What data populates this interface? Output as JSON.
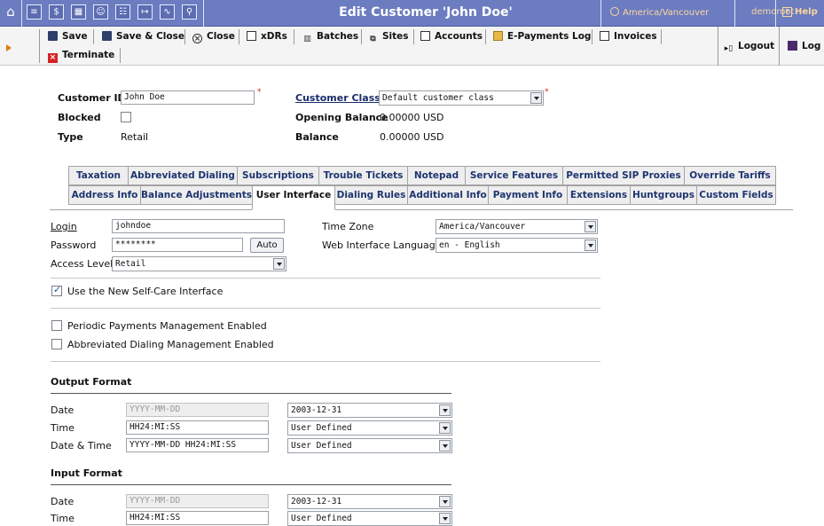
{
  "header": {
    "title": "Edit Customer 'John Doe'",
    "timezone": "America/Vancouver",
    "user": "demoroot",
    "help": "Help",
    "icons": [
      "home-icon",
      "list-icon",
      "dollar-icon",
      "grid-icon",
      "person-icon",
      "table-icon",
      "exit-icon",
      "chart-icon",
      "search-icon"
    ]
  },
  "toolbar": {
    "save": "Save",
    "save_close": "Save & Close",
    "close": "Close",
    "xdrs": "xDRs",
    "batches": "Batches",
    "sites": "Sites",
    "accounts": "Accounts",
    "epayments": "E-Payments Log",
    "invoices": "Invoices",
    "terminate": "Terminate",
    "logout": "Logout",
    "log": "Log"
  },
  "customer": {
    "id_label": "Customer ID",
    "id_value": "John Doe",
    "blocked_label": "Blocked",
    "type_label": "Type",
    "type_value": "Retail",
    "class_label": "Customer Class",
    "class_value": "Default customer class",
    "opening_label": "Opening Balance",
    "opening_value": "0.00000 USD",
    "balance_label": "Balance",
    "balance_value": "0.00000 USD"
  },
  "tabs_row1": [
    "Taxation",
    "Abbreviated Dialing",
    "Subscriptions",
    "Trouble Tickets",
    "Notepad",
    "Service Features",
    "Permitted SIP Proxies",
    "Override Tariffs"
  ],
  "tabs_row2": [
    "Address Info",
    "Balance Adjustments",
    "User Interface",
    "Dialing Rules",
    "Additional Info",
    "Payment Info",
    "Extensions",
    "Huntgroups",
    "Custom Fields"
  ],
  "active_tab": "User Interface",
  "form": {
    "login_label": "Login",
    "login_value": "johndoe",
    "password_label": "Password",
    "password_value": "********",
    "auto_button": "Auto",
    "access_label": "Access Level",
    "access_value": "Retail",
    "timezone_label": "Time Zone",
    "timezone_value": "America/Vancouver",
    "language_label": "Web Interface Language",
    "language_value": "en - English",
    "new_selfcare": "Use the New Self-Care Interface",
    "periodic": "Periodic Payments Management Enabled",
    "abbrev": "Abbreviated Dialing Management Enabled"
  },
  "output_format": {
    "title": "Output Format",
    "rows": [
      {
        "label": "Date",
        "input": "YYYY-MM-DD",
        "select": "2003-12-31"
      },
      {
        "label": "Time",
        "input": "HH24:MI:SS",
        "select": "User Defined"
      },
      {
        "label": "Date & Time",
        "input": "YYYY-MM-DD HH24:MI:SS",
        "select": "User Defined"
      }
    ]
  },
  "input_format": {
    "title": "Input Format",
    "rows": [
      {
        "label": "Date",
        "input": "YYYY-MM-DD",
        "select": "2003-12-31"
      },
      {
        "label": "Time",
        "input": "HH24:MI:SS",
        "select": "User Defined"
      }
    ]
  }
}
